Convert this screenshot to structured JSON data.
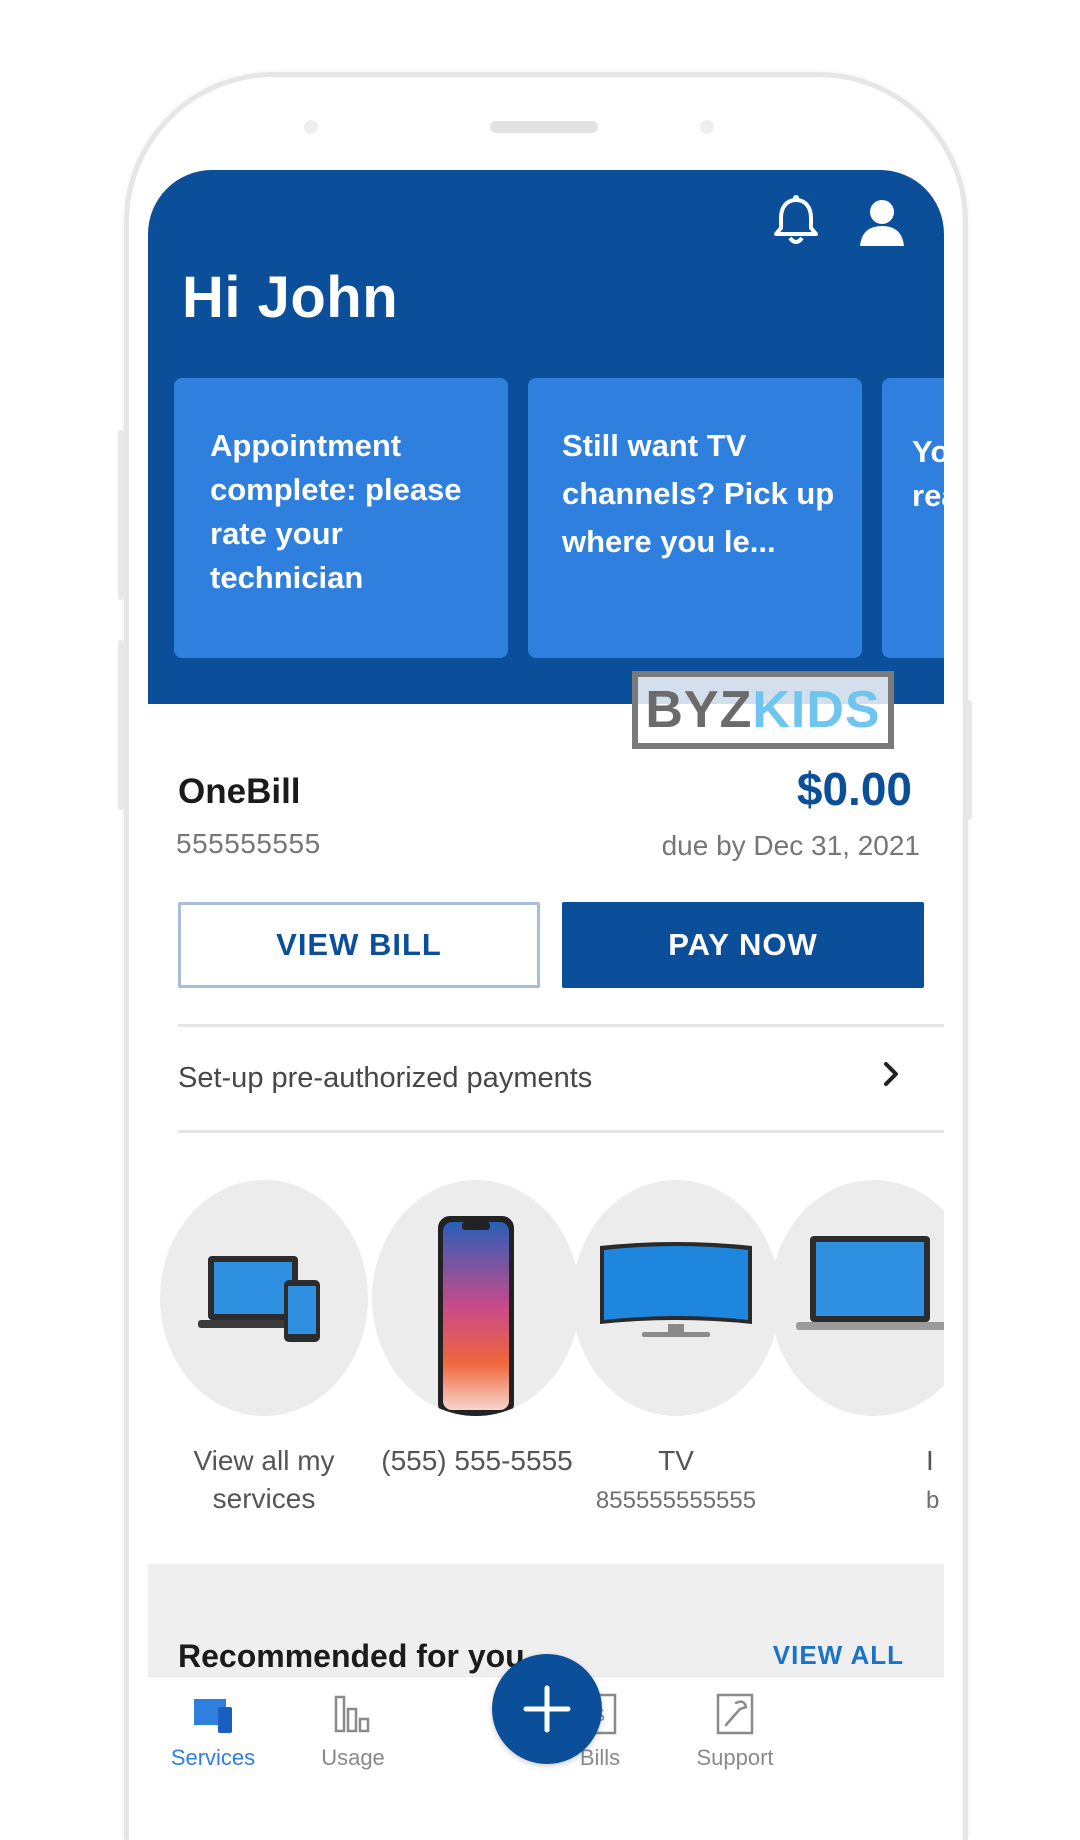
{
  "header": {
    "greeting": "Hi John",
    "cards": [
      {
        "text": "Appointment complete: please rate your technician"
      },
      {
        "text": "Still want TV channels? Pick up where you le..."
      },
      {
        "text": "Yo rea"
      }
    ]
  },
  "watermark": {
    "part_a": "BYZ",
    "part_b": "KIDS"
  },
  "bill": {
    "name": "OneBill",
    "account": "555555555",
    "amount": "$0.00",
    "due": "due by Dec 31, 2021",
    "view_label": "VIEW BILL",
    "pay_label": "PAY NOW"
  },
  "setup": {
    "label": "Set-up pre-authorized payments"
  },
  "services": [
    {
      "label": "View all my services",
      "sub": ""
    },
    {
      "label": "(555) 555-5555",
      "sub": ""
    },
    {
      "label": "TV",
      "sub": "855555555555"
    },
    {
      "label": "I",
      "sub": "b"
    }
  ],
  "recommended": {
    "title": "Recommended for you",
    "link": "VIEW ALL"
  },
  "nav": {
    "items": [
      {
        "label": "Services",
        "icon": "services-icon",
        "active": true
      },
      {
        "label": "Usage",
        "icon": "usage-icon",
        "active": false
      },
      {
        "label": "Bills",
        "icon": "bills-icon",
        "active": false
      },
      {
        "label": "Support",
        "icon": "support-icon",
        "active": false
      }
    ],
    "fab_icon": "plus-icon"
  },
  "colors": {
    "brand": "#0b4f9a",
    "card": "#2f7fdf",
    "accent_link": "#1a73c9"
  }
}
